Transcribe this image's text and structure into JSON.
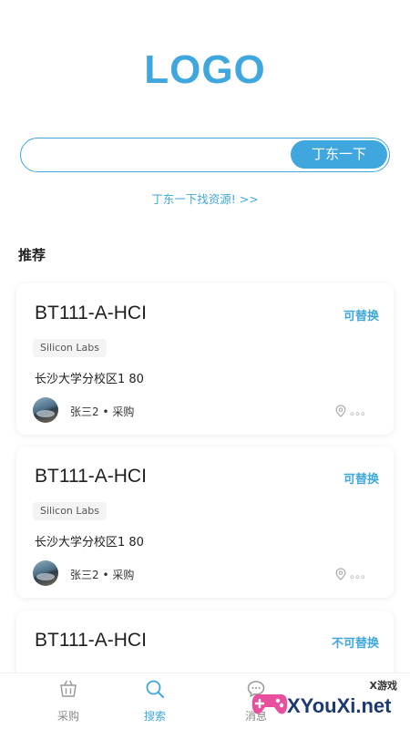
{
  "header": {
    "logo": "LOGO"
  },
  "search": {
    "placeholder": "",
    "value": "",
    "button_label": "丁东一下"
  },
  "find_link": "丁东一下找资源! >>",
  "section": {
    "title": "推荐"
  },
  "cards": [
    {
      "title": "BT111-A-HCI",
      "status": "可替换",
      "brand": "Silicon Labs",
      "address": "长沙大学分校区1 80",
      "user": "张三2 • 采购",
      "location": "。。。"
    },
    {
      "title": "BT111-A-HCI",
      "status": "可替换",
      "brand": "Silicon Labs",
      "address": "长沙大学分校区1 80",
      "user": "张三2 • 采购",
      "location": "。。。"
    },
    {
      "title": "BT111-A-HCI",
      "status": "不可替换"
    }
  ],
  "tabbar": {
    "items": [
      {
        "label": "采购",
        "icon": "basket-icon"
      },
      {
        "label": "搜索",
        "icon": "search-icon"
      },
      {
        "label": "消息",
        "icon": "message-icon"
      }
    ]
  },
  "watermark": {
    "top": "X游戏",
    "text": "XYouXi.net"
  },
  "colors": {
    "accent": "#3fa7de",
    "watermark_navy": "#1d3a70",
    "watermark_pink": "#e84f9c"
  }
}
